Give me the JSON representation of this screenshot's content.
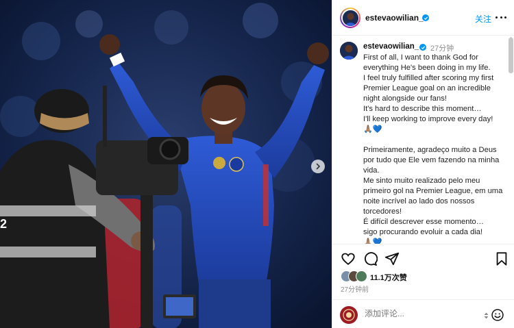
{
  "photo": {
    "alt": "Chelsea player celebrating with arms raised in front of a TV camera operator",
    "vest_number": "2"
  },
  "header": {
    "username": "estevaowilian_",
    "follow_label": "关注",
    "more_icon": "more-horizontal-icon"
  },
  "comment": {
    "username": "estevaowilian_",
    "time": "27分钟",
    "lines_en": [
      "First of all, I want to thank God for everything He's been doing in my life.",
      "I feel truly fulfilled after scoring my first Premier League goal on an incredible night alongside our fans!",
      "It's hard to describe this moment…",
      "I'll keep working to improve every day! 🙏🏽💙"
    ],
    "lines_pt": [
      "Primeiramente, agradeço muito a Deus por tudo que Ele vem fazendo na minha vida.",
      "Me sinto muito realizado pelo meu primeiro gol na Premier League, em uma noite incrível ao lado dos nossos torcedores!",
      "É difícil descrever esse momento…",
      "sigo procurando evoluir a cada dia!",
      "🙏🏽💙"
    ]
  },
  "actions": {
    "likes": "11.1万次赞",
    "time": "27分钟前",
    "icons": [
      "heart-icon",
      "comment-icon",
      "share-icon",
      "bookmark-icon"
    ]
  },
  "comment_bar": {
    "placeholder": "添加评论...",
    "emoji_icon": "smiley-icon"
  },
  "colors": {
    "accent": "#0095f6",
    "chelsea_blue": "#1f47b5",
    "text": "#222222",
    "muted": "#8e8e8e"
  }
}
